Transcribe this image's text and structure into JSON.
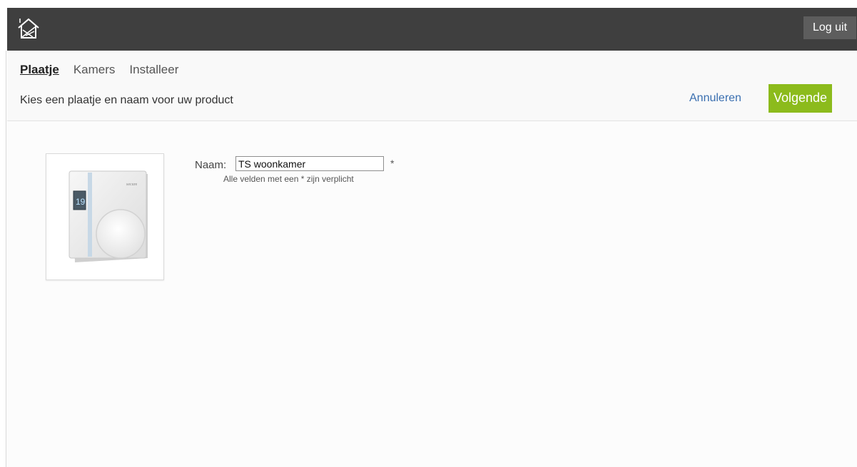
{
  "topbar": {
    "logo_icon": "house-logo-icon",
    "logout_label": "Log uit"
  },
  "wizard": {
    "tabs": [
      {
        "label": "Plaatje",
        "active": true
      },
      {
        "label": "Kamers",
        "active": false
      },
      {
        "label": "Installeer",
        "active": false
      }
    ],
    "subtitle": "Kies een plaatje en naam voor uw product",
    "cancel_label": "Annuleren",
    "next_label": "Volgende"
  },
  "form": {
    "name_label": "Naam:",
    "name_value": "TS woonkamer",
    "required_marker": "*",
    "required_note": "Alle velden met een * zijn verplicht"
  },
  "product_image": {
    "icon": "thermostat-image",
    "display_value": "19",
    "brand_text": "secure"
  },
  "colors": {
    "topbar": "#3f3f3f",
    "accent_button": "#8cbb1c",
    "link": "#3a6fb0"
  }
}
